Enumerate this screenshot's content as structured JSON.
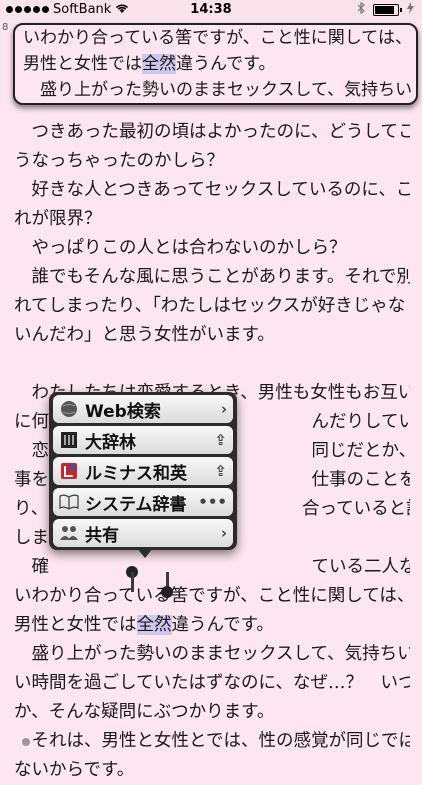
{
  "status_bar": {
    "carrier": "SoftBank",
    "time": "14:38",
    "battery_level": 0.85,
    "wifi_icon": "wifi-icon",
    "bluetooth_icon": "bluetooth-icon",
    "charging_icon": "charging-icon"
  },
  "edge_char": "8",
  "magnifier": {
    "lines": [
      "いわかり合っている筈ですが、こと性に関しては、",
      "男性と女性では全然違うんです。",
      "　盛り上がった勢いのままセックスして、気持ちい"
    ],
    "highlight": "全然"
  },
  "book": {
    "lines": [
      "　つきあった最初の頃はよかったのに、どうしてこ",
      "うなっちゃったのかしら？",
      "　好きな人とつきあってセックスしているのに、こ",
      "れが限界？",
      "　やっぱりこの人とは合わないのかしら？",
      "　誰でもそんな風に思うことがあります。それで別",
      "れてしまったり、「わたしはセックスが好きじゃな",
      "いんだわ」と思う女性がいます。",
      "",
      "　わたしたちは恋愛するとき、男性も女性もお互い",
      "に何　　　　　　　　　　　　　　　んだりしています。",
      "　恋　　　　　　　　　　　　　　　同じだとか、一緒に食",
      "事を　　　　　　　　　　　　　　　仕事のことを話した",
      "り、　　　　　　　　　　　　　　　合っていると誤解して",
      "しま　　　　　　　　　　　　　　　",
      "　確　　　　　　　　　　　　　　　ている二人なら、お互",
      "いわかり合っている筈ですが、こと性に関しては、",
      "男性と女性では全然違うんです。",
      "　盛り上がった勢いのままセックスして、気持ちい",
      "い時間を過ごしていたはずなのに、なぜ…？　いつ",
      "か、そんな疑問にぶつかります。",
      "　それは、男性と女性とでは、性の感覚が同じでは",
      "ないからです。"
    ],
    "highlight": "全然"
  },
  "menu": {
    "items": [
      {
        "label": "Web検索",
        "icon": "globe-icon",
        "trail": "chevron-right-icon"
      },
      {
        "label": "大辞林",
        "icon": "daijirin-dictionary-icon",
        "trail": "share-icon"
      },
      {
        "label": "ルミナス和英",
        "icon": "luminous-dictionary-icon",
        "trail": "share-icon"
      },
      {
        "label": "システム辞書",
        "icon": "book-icon",
        "trail": "more-icon"
      },
      {
        "label": "共有",
        "icon": "people-icon",
        "trail": "chevron-right-icon"
      }
    ]
  },
  "icon_glyphs": {
    "chevron": "›",
    "share": "⇪",
    "more": "•••"
  }
}
